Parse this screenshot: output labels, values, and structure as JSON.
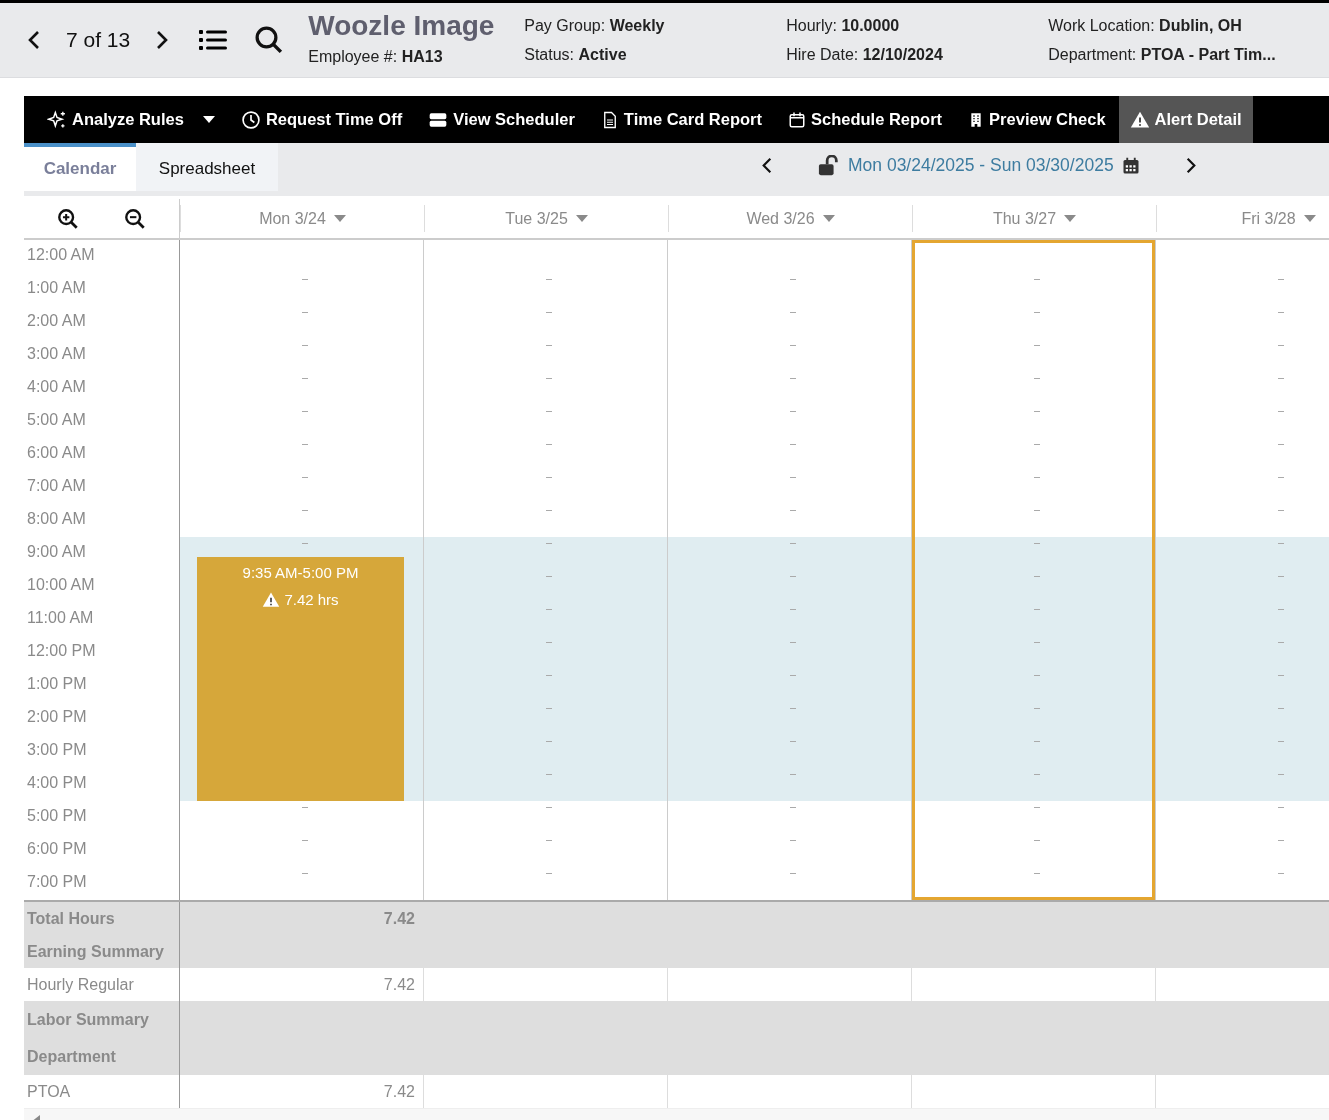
{
  "record_nav": {
    "position": "7 of 13"
  },
  "employee": {
    "name": "Woozle Image",
    "fields": [
      {
        "label": "Employee #:",
        "value": "HA13"
      },
      {
        "label": "Pay Group:",
        "value": "Weekly"
      },
      {
        "label": "Status:",
        "value": "Active"
      },
      {
        "label": "Hourly:",
        "value": "10.0000"
      },
      {
        "label": "Hire Date:",
        "value": "12/10/2024"
      },
      {
        "label": "Work Location:",
        "value": "Dublin, OH"
      },
      {
        "label": "Department:",
        "value": "PTOA - Part Tim..."
      }
    ]
  },
  "toolbar": [
    {
      "label": "Analyze Rules",
      "dropdown": true,
      "selected": false
    },
    {
      "label": "Request Time Off",
      "dropdown": false,
      "selected": false
    },
    {
      "label": "View Scheduler",
      "dropdown": false,
      "selected": false
    },
    {
      "label": "Time Card Report",
      "dropdown": false,
      "selected": false
    },
    {
      "label": "Schedule Report",
      "dropdown": false,
      "selected": false
    },
    {
      "label": "Preview Check",
      "dropdown": false,
      "selected": false
    },
    {
      "label": "Alert Detail",
      "dropdown": false,
      "selected": true
    }
  ],
  "tabs": [
    {
      "label": "Calendar",
      "selected": true
    },
    {
      "label": "Spreadsheet",
      "selected": false
    }
  ],
  "date_range": {
    "label": "Mon 03/24/2025 - Sun 03/30/2025",
    "locked": false
  },
  "days": [
    {
      "label": "Mon 3/24",
      "selected": false,
      "shift": {
        "time": "9:35 AM-5:00 PM",
        "hours": "7.42 hrs",
        "alert": true
      }
    },
    {
      "label": "Tue 3/25",
      "selected": false
    },
    {
      "label": "Wed 3/26",
      "selected": false
    },
    {
      "label": "Thu 3/27",
      "selected": true
    },
    {
      "label": "Fri 3/28",
      "selected": false
    }
  ],
  "hours": [
    {
      "label": "12:00 AM",
      "scheduled": false
    },
    {
      "label": "1:00 AM",
      "scheduled": false
    },
    {
      "label": "2:00 AM",
      "scheduled": false
    },
    {
      "label": "3:00 AM",
      "scheduled": false
    },
    {
      "label": "4:00 AM",
      "scheduled": false
    },
    {
      "label": "5:00 AM",
      "scheduled": false
    },
    {
      "label": "6:00 AM",
      "scheduled": false
    },
    {
      "label": "7:00 AM",
      "scheduled": false
    },
    {
      "label": "8:00 AM",
      "scheduled": false
    },
    {
      "label": "9:00 AM",
      "scheduled": true
    },
    {
      "label": "10:00 AM",
      "scheduled": true
    },
    {
      "label": "11:00 AM",
      "scheduled": true
    },
    {
      "label": "12:00 PM",
      "scheduled": true
    },
    {
      "label": "1:00 PM",
      "scheduled": true
    },
    {
      "label": "2:00 PM",
      "scheduled": true
    },
    {
      "label": "3:00 PM",
      "scheduled": true
    },
    {
      "label": "4:00 PM",
      "scheduled": true
    },
    {
      "label": "5:00 PM",
      "scheduled": false
    },
    {
      "label": "6:00 PM",
      "scheduled": false
    },
    {
      "label": "7:00 PM",
      "scheduled": false
    }
  ],
  "summary": [
    {
      "kind": "total",
      "label": "Total Hours",
      "values": [
        "7.42"
      ]
    },
    {
      "kind": "section",
      "label": "Earning Summary"
    },
    {
      "kind": "data",
      "label": "Hourly Regular",
      "values": [
        "7.42"
      ]
    },
    {
      "kind": "section",
      "label": "Labor Summary",
      "sublabel": "Department"
    },
    {
      "kind": "data",
      "label": "PTOA",
      "values": [
        "7.42"
      ]
    }
  ]
}
